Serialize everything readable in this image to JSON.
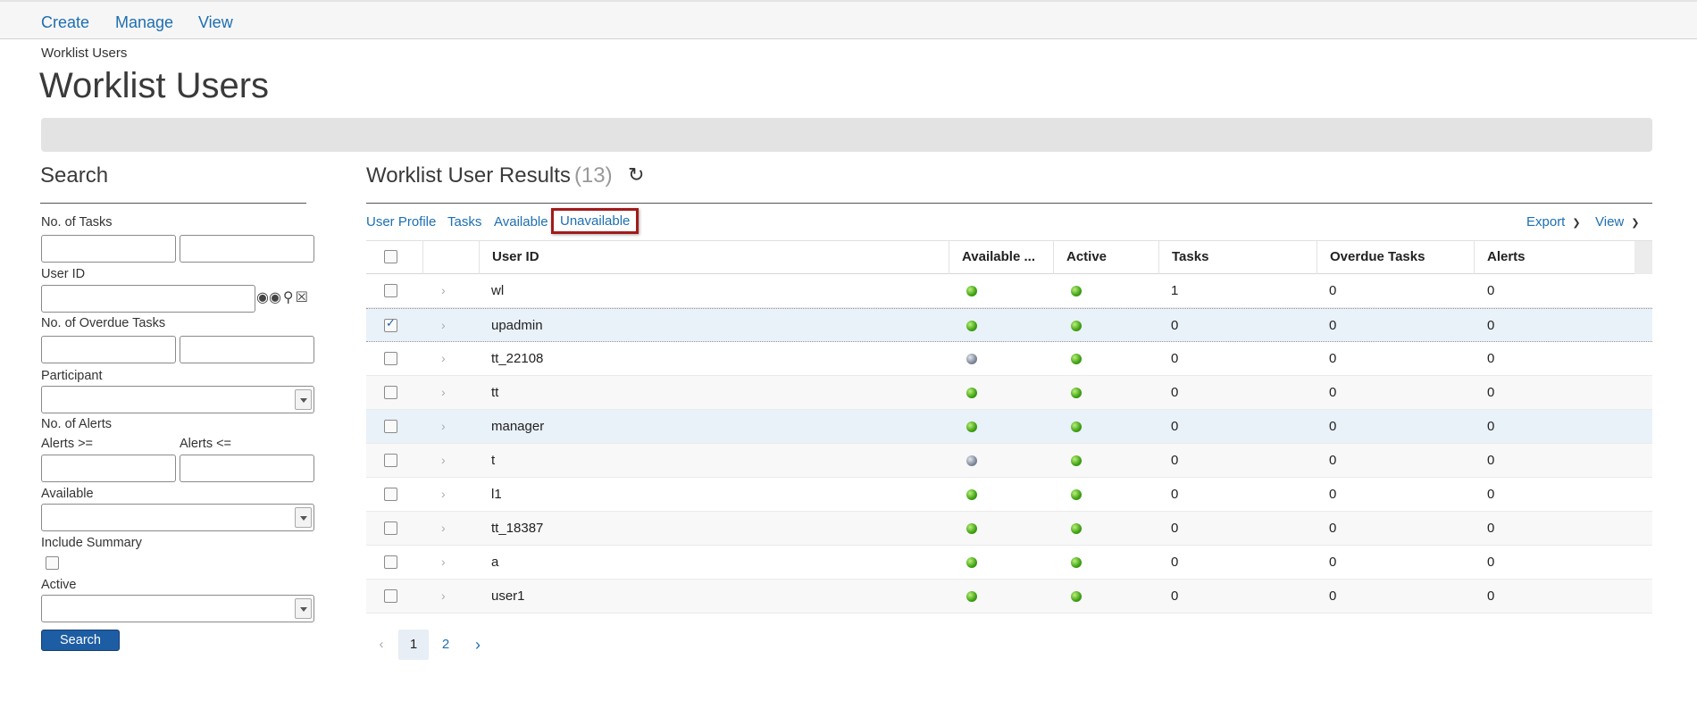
{
  "topnav": {
    "items": [
      "Create",
      "Manage",
      "View"
    ]
  },
  "breadcrumb": "Worklist Users",
  "page_title": "Worklist Users",
  "search": {
    "heading": "Search",
    "no_of_tasks_label": "No. of Tasks",
    "user_id_label": "User ID",
    "no_of_overdue_label": "No. of Overdue Tasks",
    "participant_label": "Participant",
    "no_of_alerts_label": "No. of Alerts",
    "alerts_gte_label": "Alerts >=",
    "alerts_lte_label": "Alerts <=",
    "available_label": "Available",
    "include_summary_label": "Include Summary",
    "active_label": "Active",
    "search_button": "Search",
    "user_id_icons": [
      "binoculars-icon",
      "magnifier-icon",
      "clear-icon"
    ]
  },
  "results": {
    "title": "Worklist User Results",
    "count": "(13)",
    "refresh_icon": "refresh-icon",
    "toolbar": [
      "User Profile",
      "Tasks",
      "Available",
      "Unavailable"
    ],
    "export_label": "Export",
    "view_label": "View",
    "columns": [
      "User ID",
      "Available ...",
      "Active",
      "Tasks",
      "Overdue Tasks",
      "Alerts"
    ],
    "rows": [
      {
        "user_id": "wl",
        "available": "green",
        "active": "green",
        "tasks": "1",
        "overdue": "0",
        "alerts": "0",
        "checked": false
      },
      {
        "user_id": "upadmin",
        "available": "green",
        "active": "green",
        "tasks": "0",
        "overdue": "0",
        "alerts": "0",
        "checked": true
      },
      {
        "user_id": "tt_22108",
        "available": "gray",
        "active": "green",
        "tasks": "0",
        "overdue": "0",
        "alerts": "0",
        "checked": false
      },
      {
        "user_id": "tt",
        "available": "green",
        "active": "green",
        "tasks": "0",
        "overdue": "0",
        "alerts": "0",
        "checked": false
      },
      {
        "user_id": "manager",
        "available": "green",
        "active": "green",
        "tasks": "0",
        "overdue": "0",
        "alerts": "0",
        "checked": false
      },
      {
        "user_id": "t",
        "available": "gray",
        "active": "green",
        "tasks": "0",
        "overdue": "0",
        "alerts": "0",
        "checked": false
      },
      {
        "user_id": "l1",
        "available": "green",
        "active": "green",
        "tasks": "0",
        "overdue": "0",
        "alerts": "0",
        "checked": false
      },
      {
        "user_id": "tt_18387",
        "available": "green",
        "active": "green",
        "tasks": "0",
        "overdue": "0",
        "alerts": "0",
        "checked": false
      },
      {
        "user_id": "a",
        "available": "green",
        "active": "green",
        "tasks": "0",
        "overdue": "0",
        "alerts": "0",
        "checked": false
      },
      {
        "user_id": "user1",
        "available": "green",
        "active": "green",
        "tasks": "0",
        "overdue": "0",
        "alerts": "0",
        "checked": false
      }
    ],
    "pager": {
      "prev": "‹",
      "pages": [
        "1",
        "2"
      ],
      "current": "1",
      "next": "›"
    }
  },
  "colors": {
    "link": "#1d6fb1",
    "button": "#1d5da3",
    "highlight_border": "#a11b1b",
    "status_green": "#3ea013",
    "status_gray": "#7e8898"
  }
}
